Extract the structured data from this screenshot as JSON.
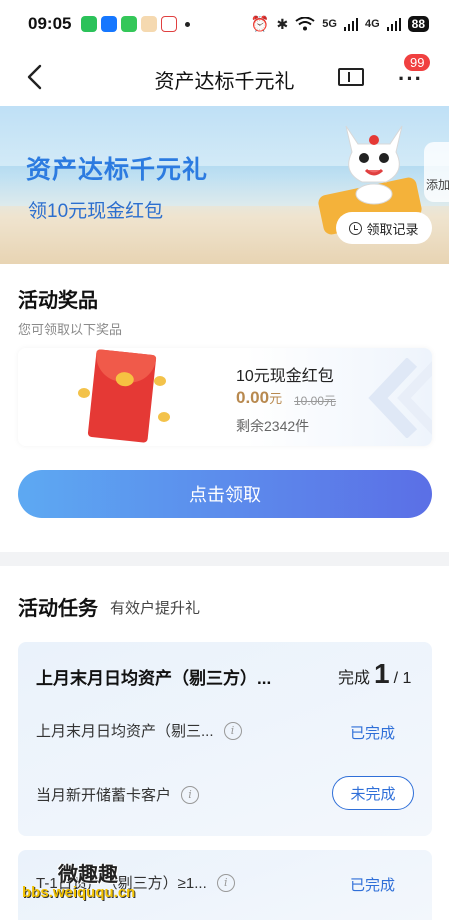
{
  "status_bar": {
    "time": "09:05",
    "signal_5g": "5G",
    "signal_4g": "4G",
    "battery": "88"
  },
  "nav": {
    "title": "资产达标千元礼",
    "more_badge": "99"
  },
  "banner": {
    "headline": "资产达标千元礼",
    "subline": "领10元现金红包",
    "side_label": "添加",
    "record_label": "领取记录"
  },
  "prize_section": {
    "title": "活动奖品",
    "subtitle": "您可领取以下奖品",
    "prize": {
      "name": "10元现金红包",
      "price": "0.00",
      "price_unit": "元",
      "original_price": "10.00元",
      "remaining": "剩余2342件"
    },
    "claim_button": "点击领取"
  },
  "task_section": {
    "title": "活动任务",
    "subtitle": "有效户提升礼",
    "group": {
      "title": "上月末月日均资产（剔三方）...",
      "progress_prefix": "完成",
      "progress_done": "1",
      "progress_total": "/ 1",
      "items": [
        {
          "label": "上月末月日均资产（剔三...",
          "status": "已完成"
        },
        {
          "label": "当月新开储蓄卡客户",
          "status": "未完成"
        }
      ]
    },
    "next_item": {
      "label": "T-1日资产（剔三方）≥1...",
      "status": "已完成"
    }
  },
  "watermark": {
    "line1": "微趣趣",
    "line2": "bbs.weiququ.cn"
  },
  "colors": {
    "accent_blue": "#2f6fd8",
    "button_gradient_start": "#5da9f2",
    "button_gradient_end": "#5b6fe6",
    "price_gold": "#b8894f",
    "badge_red": "#f04040"
  }
}
